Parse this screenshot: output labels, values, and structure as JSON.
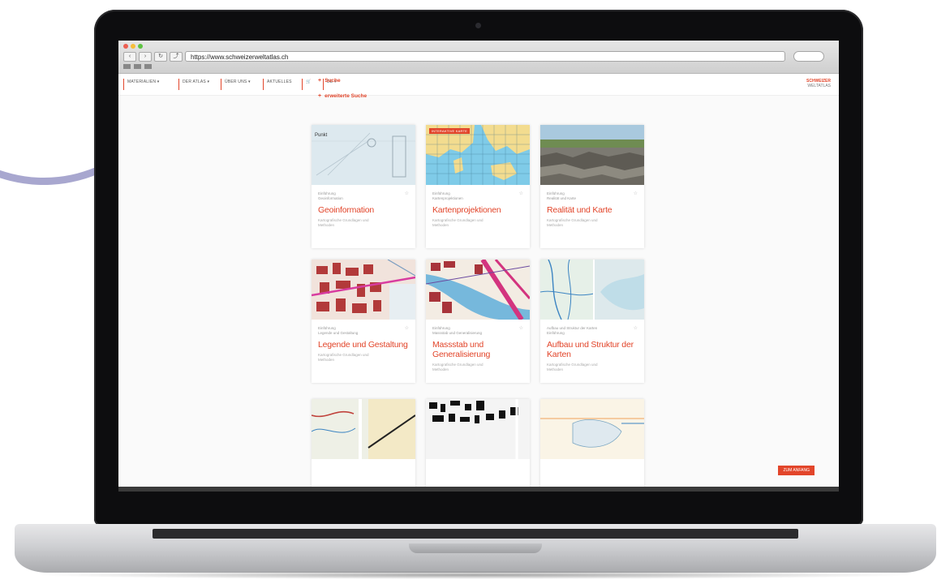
{
  "browser": {
    "url": "https://www.schweizerweltatlas.ch",
    "back_icon": "back-arrow-icon",
    "forward_icon": "forward-arrow-icon",
    "reload_icon": "reload-icon",
    "share_icon": "share-icon"
  },
  "site_nav": {
    "items": [
      {
        "label": "MATERIALIEN ▾"
      },
      {
        "label": "DER ATLAS ▾"
      },
      {
        "label": "ÜBER UNS ▾"
      },
      {
        "label": "AKTUELLES"
      },
      {
        "label": "🛒"
      },
      {
        "label": "DE ▾"
      }
    ],
    "logo_line1": "SCHWEIZER",
    "logo_line2": "WELTATLAS"
  },
  "search": {
    "simple": "Suche",
    "advanced": "erweiterte Suche"
  },
  "cards": [
    {
      "meta1": "Einführung",
      "meta2": "Geoinformation",
      "title": "Geoinformation",
      "desc1": "Kartografische Grundlagen und",
      "desc2": "Methoden",
      "tag": ""
    },
    {
      "meta1": "Einführung",
      "meta2": "Kartenprojektionen",
      "title": "Kartenprojektionen",
      "desc1": "Kartografische Grundlagen und",
      "desc2": "Methoden",
      "tag": "INTERAKTIVE KARTE"
    },
    {
      "meta1": "Einführung",
      "meta2": "Realität und Karte",
      "title": "Realität und Karte",
      "desc1": "Kartografische Grundlagen und",
      "desc2": "Methoden",
      "tag": ""
    },
    {
      "meta1": "Einführung",
      "meta2": "Legende und Gestaltung",
      "title": "Legende und Gestaltung",
      "desc1": "Kartografische Grundlagen und",
      "desc2": "Methoden",
      "tag": ""
    },
    {
      "meta1": "Einführung",
      "meta2": "Massstab und Generalisierung",
      "title": "Massstab und Generalisierung",
      "desc1": "Kartografische Grundlagen und",
      "desc2": "Methoden",
      "tag": ""
    },
    {
      "meta1": "Aufbau und Struktur der Karten",
      "meta2": "Einführung",
      "title": "Aufbau und Struktur der Karten",
      "desc1": "Kartografische Grundlagen und",
      "desc2": "Methoden",
      "tag": ""
    }
  ],
  "bottom_button": "ZUM ANFANG",
  "colors": {
    "accent": "#e2452a",
    "lid": "#0d0d0f",
    "arc": "#a8a7cf"
  }
}
